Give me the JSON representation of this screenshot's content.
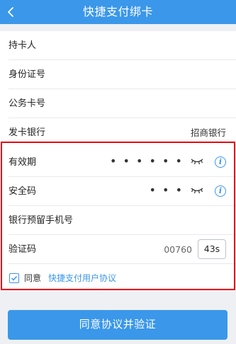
{
  "nav": {
    "title": "快捷支付绑卡",
    "back_icon": "chevron-left-icon"
  },
  "form": {
    "cardholder_label": "持卡人",
    "id_number_label": "身份证号",
    "card_number_label": "公务卡号",
    "issuing_bank_label": "发卡银行",
    "issuing_bank_value": "招商银行",
    "expiry_label": "有效期",
    "expiry_value": "• • • • • •",
    "cvv_label": "安全码",
    "cvv_value": "• • •",
    "phone_label": "银行预留手机号",
    "verification_label": "验证码",
    "verification_value": "00760",
    "countdown": "43s"
  },
  "agreement": {
    "checked": true,
    "prefix": "同意",
    "link_text": "快捷支付用户协议"
  },
  "submit_label": "同意协议并验证",
  "colors": {
    "accent": "#3a97ea",
    "highlight_border": "#e60012"
  }
}
